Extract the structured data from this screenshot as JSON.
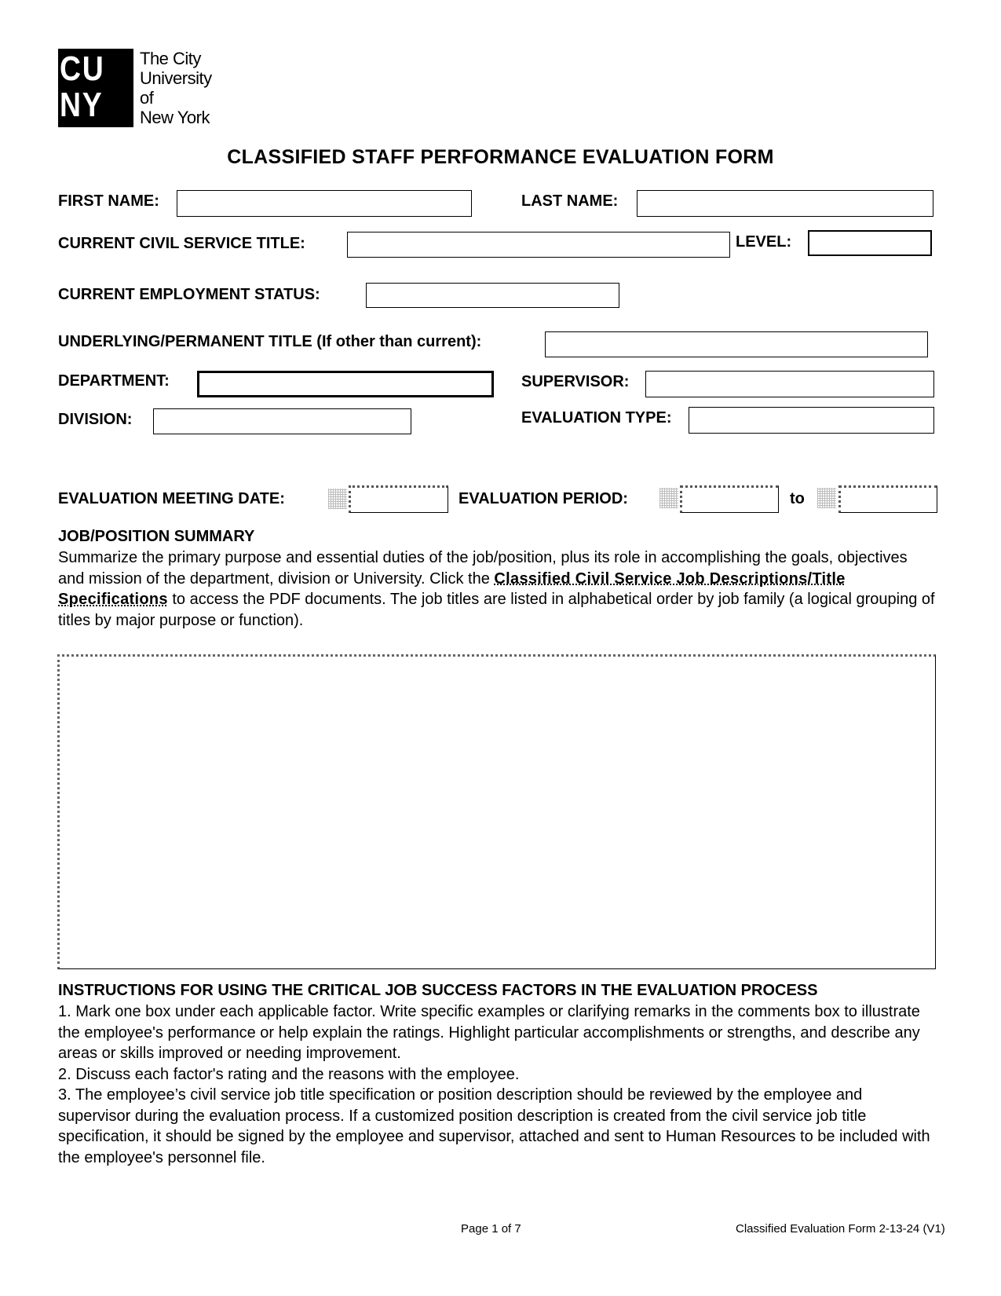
{
  "logo": {
    "mark_line1": "CU",
    "mark_line2": "NY",
    "text_lines": [
      "The City",
      "University",
      "of",
      "New York"
    ]
  },
  "title": "CLASSIFIED STAFF PERFORMANCE EVALUATION FORM",
  "fields": {
    "first_name": {
      "label": "FIRST NAME:",
      "value": ""
    },
    "last_name": {
      "label": "LAST NAME:",
      "value": ""
    },
    "civil_service_title": {
      "label": "CURRENT CIVIL SERVICE TITLE:",
      "value": ""
    },
    "level": {
      "label": "LEVEL:",
      "value": ""
    },
    "employment_status": {
      "label": "CURRENT EMPLOYMENT STATUS:",
      "value": ""
    },
    "underlying_title": {
      "label_bold": "UNDERLYING/PERMANENT TITLE",
      "label_paren": " (If other than current):",
      "value": ""
    },
    "department": {
      "label": "DEPARTMENT:",
      "value": ""
    },
    "supervisor": {
      "label": "SUPERVISOR:",
      "value": ""
    },
    "division": {
      "label": "DIVISION:",
      "value": ""
    },
    "evaluation_type": {
      "label": "EVALUATION TYPE:",
      "value": ""
    },
    "meeting_date": {
      "label": "EVALUATION MEETING DATE:",
      "value": ""
    },
    "period": {
      "label": "EVALUATION PERIOD:",
      "from": "",
      "to_label": "to",
      "to": ""
    }
  },
  "job_summary": {
    "heading": "JOB/POSITION SUMMARY",
    "text_before_link": "Summarize the primary purpose and essential duties of the job/position, plus its role in accomplishing the goals, objectives and mission of the department, division or University. Click the ",
    "link_text": "Classified Civil Service Job Descriptions/Title Specifications",
    "text_after_link": " to access the PDF documents. The job titles are listed in alphabetical order by job family (a logical grouping of titles by major purpose or function).",
    "value": ""
  },
  "instructions": {
    "heading": "INSTRUCTIONS FOR USING THE CRITICAL JOB SUCCESS FACTORS IN THE EVALUATION PROCESS",
    "items": [
      "1. Mark one box under each applicable factor. Write specific examples or clarifying remarks in the comments box to illustrate the employee's performance or help explain the ratings. Highlight particular accomplishments or strengths, and describe any areas or skills improved or needing improvement.",
      "2. Discuss each factor's rating and the reasons with the employee.",
      "3. The employee’s civil service job title specification or position description should be reviewed by the employee and supervisor during the evaluation process. If a customized position description is created from the civil service job title specification, it should be signed by the employee and supervisor, attached and sent to Human Resources to be included with the employee's personnel file."
    ]
  },
  "footer": {
    "page": "Page 1 of 7",
    "form_id": "Classified Evaluation Form 2-13-24 (V1)"
  }
}
